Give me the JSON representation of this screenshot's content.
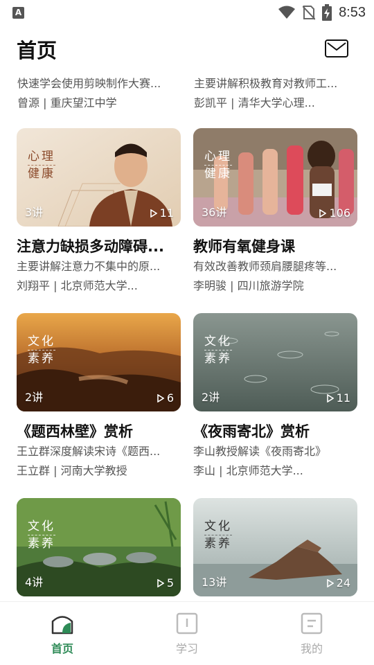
{
  "status_bar": {
    "time": "8:53",
    "app_icon_letter": "A"
  },
  "header": {
    "title": "首页"
  },
  "top_partial": [
    {
      "desc": "快速学会使用剪映制作大赛...",
      "meta": "曾源 | 重庆望江中学"
    },
    {
      "desc": "主要讲解积极教育对教师工...",
      "meta": "彭凯平 | 清华大学心理..."
    }
  ],
  "cards": [
    {
      "tag_line1": "心理",
      "tag_line2": "健康",
      "lessons": "3讲",
      "plays": "11",
      "title": "注意力缺损多动障碍...",
      "desc": "主要讲解注意力不集中的原...",
      "meta": "刘翔平 | 北京师范大学..."
    },
    {
      "tag_line1": "心理",
      "tag_line2": "健康",
      "lessons": "36讲",
      "plays": "106",
      "title": "教师有氧健身课",
      "desc": "有效改善教师颈肩腰腿疼等...",
      "meta": "李明骏 | 四川旅游学院"
    },
    {
      "tag_line1": "文化",
      "tag_line2": "素养",
      "lessons": "2讲",
      "plays": "6",
      "title": "《题西林壁》赏析",
      "desc": "王立群深度解读宋诗《题西...",
      "meta": "王立群 | 河南大学教授"
    },
    {
      "tag_line1": "文化",
      "tag_line2": "素养",
      "lessons": "2讲",
      "plays": "11",
      "title": "《夜雨寄北》赏析",
      "desc": "李山教授解读《夜雨寄北》",
      "meta": "李山 | 北京师范大学..."
    },
    {
      "tag_line1": "文化",
      "tag_line2": "素养",
      "lessons": "4讲",
      "plays": "5",
      "title": "",
      "desc": "",
      "meta": ""
    },
    {
      "tag_line1": "文化",
      "tag_line2": "素养",
      "lessons": "13讲",
      "plays": "24",
      "title": "",
      "desc": "",
      "meta": ""
    }
  ],
  "tabbar": {
    "home": "首页",
    "study": "学习",
    "mine": "我的",
    "active_color": "#2e8b57",
    "inactive_color": "#aaaaaa"
  }
}
